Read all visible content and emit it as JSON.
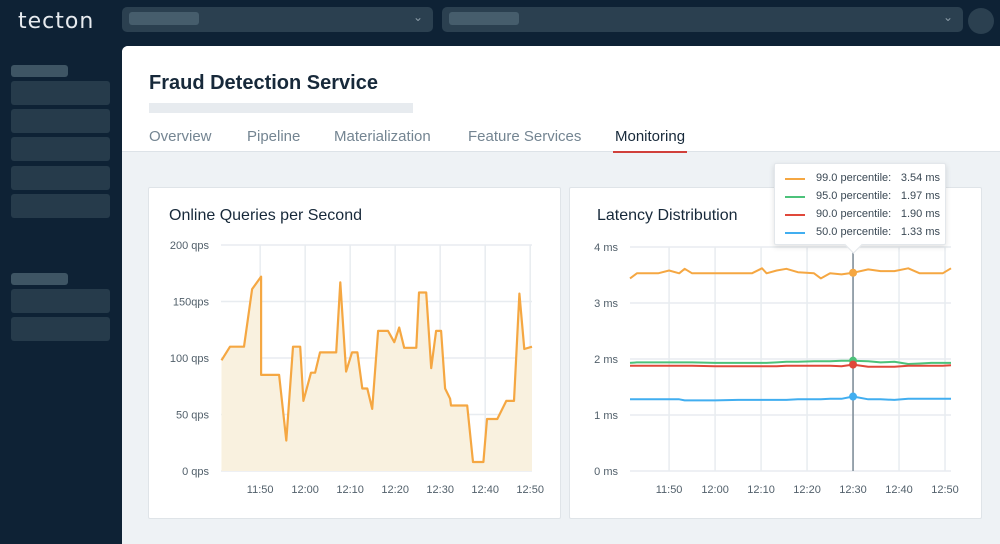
{
  "app": {
    "logo_text": "tecton",
    "org_select_value": "",
    "workspace_select_value": ""
  },
  "icons": {
    "chevron": "chevron-down-icon",
    "avatar": "user-avatar"
  },
  "header": {
    "title": "Fraud Detection Service",
    "tabs": [
      {
        "label": "Overview",
        "active": false
      },
      {
        "label": "Pipeline",
        "active": false
      },
      {
        "label": "Materialization",
        "active": false
      },
      {
        "label": "Feature Services",
        "active": false
      },
      {
        "label": "Monitoring",
        "active": true
      }
    ]
  },
  "colors": {
    "accent": "#d0403a",
    "p99": "#f5a742",
    "p95": "#4cc27a",
    "p90": "#e0483a",
    "p50": "#41aef0",
    "area_fill": "#f9f1df"
  },
  "chart_data": [
    {
      "type": "area",
      "title": "Online Queries per Second",
      "xlabel": "",
      "ylabel": "",
      "x_tick_labels": [
        "11:50",
        "12:00",
        "12:10",
        "12:20",
        "12:30",
        "12:40",
        "12:50"
      ],
      "y_tick_labels": [
        "0 qps",
        "50 qps",
        "100 qps",
        "150qps",
        "200 qps"
      ],
      "y_ticks": [
        0,
        50,
        100,
        150,
        200
      ],
      "ylim": [
        0,
        200
      ],
      "x_unit": "minutes since 11:40",
      "xlim": [
        1.3,
        70.4
      ],
      "grid": true,
      "series": [
        {
          "name": "qps",
          "x": [
            1.4,
            3.3,
            6.4,
            8.2,
            10.2,
            10.2,
            14.2,
            15.8,
            17.3,
            18.9,
            19.6,
            21.3,
            22.2,
            23.3,
            26.9,
            27.8,
            29.1,
            30.4,
            31.6,
            32.7,
            33.8,
            34.9,
            36.2,
            38.4,
            39.8,
            40.9,
            42.0,
            44.7,
            45.3,
            46.9,
            48.0,
            49.1,
            50.2,
            51.1,
            52.2,
            52.4,
            56.0,
            57.3,
            59.6,
            60.4,
            62.7,
            64.7,
            66.4,
            67.6,
            68.7,
            70.4
          ],
          "values": [
            98,
            110,
            110,
            161,
            172,
            85,
            85,
            27,
            110,
            110,
            62,
            87,
            87,
            105,
            105,
            167,
            88,
            105,
            105,
            73,
            73,
            55,
            124,
            124,
            114,
            127,
            109,
            109,
            158,
            158,
            91,
            124,
            124,
            73,
            64,
            58,
            58,
            8,
            8,
            46,
            46,
            62,
            62,
            157,
            108,
            110
          ]
        }
      ]
    },
    {
      "type": "line",
      "title": "Latency Distribution",
      "xlabel": "",
      "ylabel": "",
      "x_tick_labels": [
        "11:50",
        "12:00",
        "12:10",
        "12:20",
        "12:30",
        "12:40",
        "12:50"
      ],
      "y_tick_labels": [
        "0 ms",
        "1 ms",
        "2 ms",
        "3 ms",
        "4 ms"
      ],
      "y_ticks": [
        0,
        1,
        2,
        3,
        4
      ],
      "ylim": [
        0,
        4
      ],
      "x_unit": "minutes since 11:40",
      "xlim": [
        1.5,
        71.3
      ],
      "grid": true,
      "hover_x": 50.0,
      "x": [
        1.5,
        3.0,
        5.6,
        7.6,
        10.0,
        12.2,
        13.4,
        15.0,
        20.0,
        25.0,
        28.0,
        30.2,
        31.2,
        33.4,
        35.5,
        38.0,
        41.5,
        43.0,
        45.0,
        47.5,
        50.0,
        53.3,
        56.0,
        59.0,
        62.0,
        64.5,
        67.0,
        69.5,
        71.3
      ],
      "series": [
        {
          "name": "99.0 percentile",
          "color_key": "p99",
          "values": [
            3.44,
            3.53,
            3.53,
            3.53,
            3.58,
            3.53,
            3.61,
            3.53,
            3.53,
            3.53,
            3.53,
            3.62,
            3.53,
            3.58,
            3.61,
            3.55,
            3.53,
            3.44,
            3.53,
            3.51,
            3.54,
            3.6,
            3.57,
            3.57,
            3.62,
            3.53,
            3.53,
            3.53,
            3.62
          ]
        },
        {
          "name": "95.0 percentile",
          "color_key": "p95",
          "values": [
            1.93,
            1.94,
            1.94,
            1.94,
            1.94,
            1.94,
            1.94,
            1.94,
            1.93,
            1.93,
            1.93,
            1.93,
            1.93,
            1.94,
            1.95,
            1.95,
            1.96,
            1.96,
            1.96,
            1.97,
            1.97,
            1.96,
            1.94,
            1.95,
            1.91,
            1.92,
            1.93,
            1.93,
            1.93
          ]
        },
        {
          "name": "90.0 percentile",
          "color_key": "p90",
          "values": [
            1.88,
            1.88,
            1.88,
            1.88,
            1.88,
            1.88,
            1.88,
            1.88,
            1.87,
            1.87,
            1.87,
            1.87,
            1.87,
            1.87,
            1.88,
            1.88,
            1.88,
            1.88,
            1.88,
            1.87,
            1.9,
            1.86,
            1.86,
            1.86,
            1.88,
            1.88,
            1.88,
            1.88,
            1.89
          ]
        },
        {
          "name": "50.0 percentile",
          "color_key": "p50",
          "values": [
            1.28,
            1.28,
            1.28,
            1.28,
            1.28,
            1.28,
            1.26,
            1.26,
            1.26,
            1.27,
            1.27,
            1.27,
            1.27,
            1.27,
            1.27,
            1.28,
            1.28,
            1.28,
            1.29,
            1.29,
            1.33,
            1.28,
            1.28,
            1.27,
            1.29,
            1.29,
            1.29,
            1.29,
            1.29
          ]
        }
      ],
      "tooltip": [
        {
          "label": "99.0 percentile:",
          "value": "3.54 ms",
          "color_key": "p99"
        },
        {
          "label": "95.0 percentile:",
          "value": "1.97 ms",
          "color_key": "p95"
        },
        {
          "label": "90.0 percentile:",
          "value": "1.90 ms",
          "color_key": "p90"
        },
        {
          "label": "50.0 percentile:",
          "value": "1.33 ms",
          "color_key": "p50"
        }
      ]
    }
  ]
}
